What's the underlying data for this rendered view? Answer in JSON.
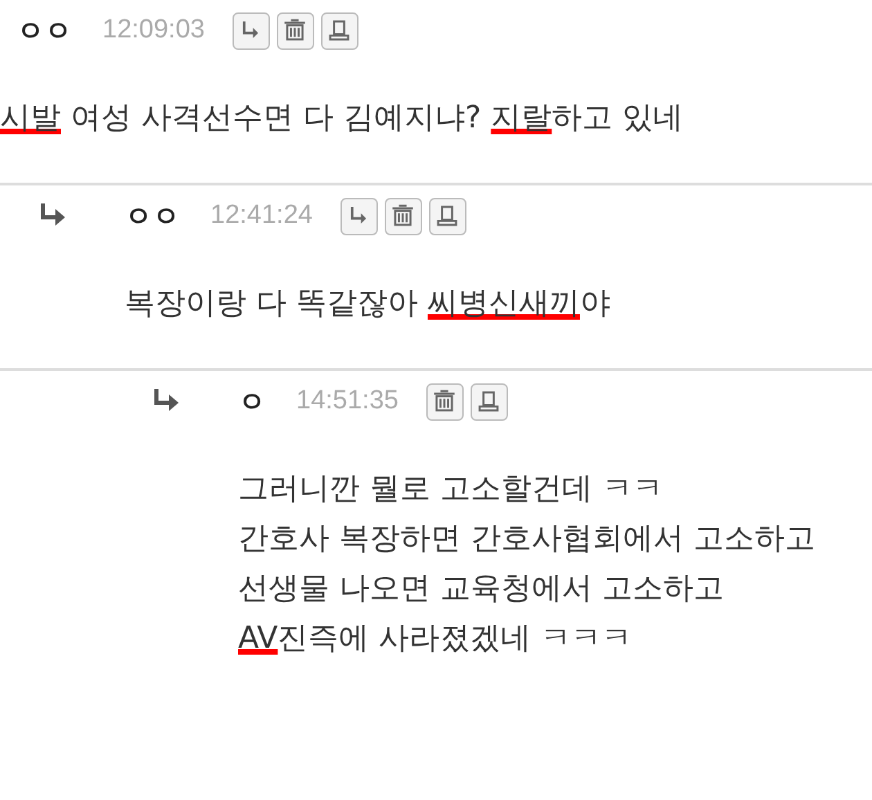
{
  "comments": [
    {
      "author": "ㅇㅇ",
      "time": "12:09:03",
      "actions": [
        {
          "kind": "reply"
        },
        {
          "kind": "delete"
        },
        {
          "kind": "report"
        }
      ],
      "lines": [
        [
          {
            "text": "시발",
            "redacted": true
          },
          {
            "text": " 여성 사격선수면 다 김예지냐? ",
            "redacted": false
          },
          {
            "text": "지랄",
            "redacted": true
          },
          {
            "text": "하고 있네",
            "redacted": false
          }
        ]
      ],
      "children": [
        {
          "author": "ㅇㅇ",
          "time": "12:41:24",
          "actions": [
            {
              "kind": "reply"
            },
            {
              "kind": "delete"
            },
            {
              "kind": "report"
            }
          ],
          "lines": [
            [
              {
                "text": "복장이랑 다 똑같잖아 ",
                "redacted": false
              },
              {
                "text": "씨병신새끼",
                "redacted": true
              },
              {
                "text": "야",
                "redacted": false
              }
            ]
          ],
          "children": [
            {
              "author": "ㅇ",
              "time": "14:51:35",
              "actions": [
                {
                  "kind": "delete"
                },
                {
                  "kind": "report"
                }
              ],
              "lines": [
                [
                  {
                    "text": "그러니깐 뭘로 고소할건데 ㅋㅋ",
                    "redacted": false
                  }
                ],
                [
                  {
                    "text": "간호사 복장하면 간호사협회에서 고소하고",
                    "redacted": false
                  }
                ],
                [
                  {
                    "text": "선생물 나오면 교육청에서 고소하고",
                    "redacted": false
                  }
                ],
                [
                  {
                    "text": "AV",
                    "redacted": true
                  },
                  {
                    "text": "진즉에 사라졌겠네 ㅋㅋㅋ",
                    "redacted": false
                  }
                ]
              ]
            }
          ]
        }
      ]
    }
  ]
}
